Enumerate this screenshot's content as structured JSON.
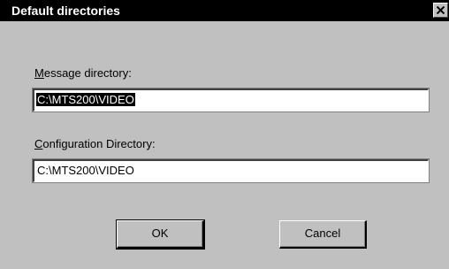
{
  "window": {
    "title": "Default directories",
    "close_symbol": "close-icon"
  },
  "message_directory": {
    "label_underlined": "M",
    "label_rest": "essage directory:",
    "value": "C:\\MTS200\\VIDEO"
  },
  "configuration_directory": {
    "label_underlined": "C",
    "label_rest": "onfiguration Directory:",
    "value": "C:\\MTS200\\VIDEO"
  },
  "buttons": {
    "ok_label": "OK",
    "cancel_label": "Cancel"
  },
  "colors": {
    "dialog_background": "#c0c0c0",
    "titlebar": "#000000",
    "selection": "#000000"
  }
}
